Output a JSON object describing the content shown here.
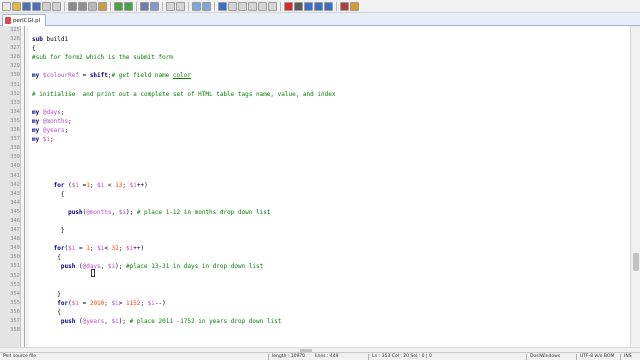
{
  "toolbar": {
    "buttons": [
      {
        "icon": "new-file-icon",
        "color": "#e9e9e9"
      },
      {
        "icon": "open-folder-icon",
        "color": "#e2b84a"
      },
      {
        "icon": "save-icon",
        "color": "#4a6fb5"
      },
      {
        "icon": "save-all-icon",
        "color": "#4a6fb5"
      },
      {
        "icon": "close-icon",
        "color": "#d0d0d0"
      },
      {
        "icon": "close-all-icon",
        "color": "#d0d0d0"
      },
      {
        "icon": "print-icon",
        "color": "#8a8a8a"
      },
      {
        "icon": "cut-icon",
        "color": "#8f8f8f"
      },
      {
        "icon": "copy-icon",
        "color": "#b9b9b9"
      },
      {
        "icon": "paste-icon",
        "color": "#c89a4a"
      },
      {
        "icon": "undo-icon",
        "color": "#4aa04a"
      },
      {
        "icon": "redo-icon",
        "color": "#4aa04a"
      },
      {
        "icon": "find-icon",
        "color": "#6b7fa8"
      },
      {
        "icon": "replace-icon",
        "color": "#7f9ad1"
      },
      {
        "icon": "zoom-in-icon",
        "color": "#d4d4d4"
      },
      {
        "icon": "zoom-out-icon",
        "color": "#d4d4d4"
      },
      {
        "icon": "sync-vertical-icon",
        "color": "#7fa7d9"
      },
      {
        "icon": "sync-horizontal-icon",
        "color": "#7fa7d9"
      },
      {
        "icon": "word-wrap-icon",
        "color": "#3b6fc4"
      },
      {
        "icon": "show-all-chars-icon",
        "color": "#d4d4d4"
      },
      {
        "icon": "indent-guide-icon",
        "color": "#d4d4d4"
      },
      {
        "icon": "define-language-icon",
        "color": "#d4d4d4"
      },
      {
        "icon": "doc-map-icon",
        "color": "#d4d4d4"
      },
      {
        "icon": "function-list-icon",
        "color": "#d4d4d4"
      },
      {
        "icon": "record-macro-icon",
        "color": "#d42a2a"
      },
      {
        "icon": "stop-recording-icon",
        "color": "#5a5a5a"
      },
      {
        "icon": "playback-macro-icon",
        "color": "#3b6fc4"
      },
      {
        "icon": "run-macro-multiple-icon",
        "color": "#3b6fc4"
      },
      {
        "icon": "save-macro-icon",
        "color": "#3b6fc4"
      },
      {
        "icon": "spell-check-icon",
        "color": "#b04040"
      },
      {
        "icon": "plugin-icon",
        "color": "#d49a2a"
      }
    ]
  },
  "tabs": [
    {
      "label": "perlCGI.pl",
      "icon": "perl-file-icon",
      "color": "#d94b4b"
    }
  ],
  "editor": {
    "lines": [
      {
        "n": "325",
        "segs": []
      },
      {
        "n": "326",
        "segs": [
          {
            "t": "sub ",
            "c": "kw"
          },
          {
            "t": "build1",
            "c": ""
          }
        ]
      },
      {
        "n": "327",
        "segs": [
          {
            "t": "{",
            "c": ""
          }
        ]
      },
      {
        "n": "328",
        "segs": [
          {
            "t": "#sub for form2 which is the submit form",
            "c": "cmt"
          }
        ]
      },
      {
        "n": "329",
        "segs": []
      },
      {
        "n": "330",
        "segs": [
          {
            "t": "my ",
            "c": "kw"
          },
          {
            "t": "$colourRef",
            "c": "var"
          },
          {
            "t": " = ",
            "c": ""
          },
          {
            "t": "shift",
            "c": "kw"
          },
          {
            "t": ";",
            "c": ""
          },
          {
            "t": "# get field name ",
            "c": "cmt"
          },
          {
            "t": "color",
            "c": "cmt und"
          }
        ]
      },
      {
        "n": "331",
        "segs": []
      },
      {
        "n": "332",
        "segs": [
          {
            "t": "# initialise  and print out a complete set of HTML table tags name, value, and index",
            "c": "cmt"
          }
        ]
      },
      {
        "n": "333",
        "segs": []
      },
      {
        "n": "334",
        "segs": [
          {
            "t": "my ",
            "c": "kw"
          },
          {
            "t": "@days",
            "c": "var"
          },
          {
            "t": ";",
            "c": ""
          }
        ]
      },
      {
        "n": "335",
        "segs": [
          {
            "t": "my ",
            "c": "kw"
          },
          {
            "t": "@months",
            "c": "var"
          },
          {
            "t": ";",
            "c": ""
          }
        ]
      },
      {
        "n": "336",
        "segs": [
          {
            "t": "my ",
            "c": "kw"
          },
          {
            "t": "@years",
            "c": "var"
          },
          {
            "t": ";",
            "c": ""
          }
        ]
      },
      {
        "n": "337",
        "segs": [
          {
            "t": "my ",
            "c": "kw"
          },
          {
            "t": "$i",
            "c": "var"
          },
          {
            "t": ";",
            "c": ""
          }
        ]
      },
      {
        "n": "338",
        "segs": []
      },
      {
        "n": "339",
        "segs": []
      },
      {
        "n": "340",
        "segs": []
      },
      {
        "n": "341",
        "segs": []
      },
      {
        "n": "342",
        "segs": [
          {
            "t": "      for ",
            "c": "kw"
          },
          {
            "t": "(",
            "c": ""
          },
          {
            "t": "$i",
            "c": "var"
          },
          {
            "t": " =",
            "c": ""
          },
          {
            "t": "1",
            "c": "num"
          },
          {
            "t": "; ",
            "c": ""
          },
          {
            "t": "$i",
            "c": "var"
          },
          {
            "t": " < ",
            "c": ""
          },
          {
            "t": "13",
            "c": "num"
          },
          {
            "t": "; ",
            "c": ""
          },
          {
            "t": "$i",
            "c": "var"
          },
          {
            "t": "++)",
            "c": ""
          }
        ]
      },
      {
        "n": "343",
        "segs": [
          {
            "t": "        {",
            "c": ""
          }
        ]
      },
      {
        "n": "344",
        "segs": []
      },
      {
        "n": "345",
        "segs": [
          {
            "t": "          push",
            "c": "kw"
          },
          {
            "t": "(",
            "c": ""
          },
          {
            "t": "@months",
            "c": "var"
          },
          {
            "t": ", ",
            "c": ""
          },
          {
            "t": "$i",
            "c": "var"
          },
          {
            "t": "); ",
            "c": ""
          },
          {
            "t": "# place 1-12 in months drop down list",
            "c": "cmt"
          }
        ]
      },
      {
        "n": "346",
        "segs": []
      },
      {
        "n": "347",
        "segs": [
          {
            "t": "        }",
            "c": ""
          }
        ]
      },
      {
        "n": "348",
        "segs": []
      },
      {
        "n": "349",
        "segs": [
          {
            "t": "      for",
            "c": "kw"
          },
          {
            "t": "(",
            "c": ""
          },
          {
            "t": "$i",
            "c": "var"
          },
          {
            "t": " = ",
            "c": ""
          },
          {
            "t": "1",
            "c": "num"
          },
          {
            "t": "; ",
            "c": ""
          },
          {
            "t": "$i",
            "c": "var"
          },
          {
            "t": "< ",
            "c": ""
          },
          {
            "t": "32",
            "c": "num"
          },
          {
            "t": "; ",
            "c": ""
          },
          {
            "t": "$i",
            "c": "var"
          },
          {
            "t": "++)",
            "c": ""
          }
        ]
      },
      {
        "n": "350",
        "segs": [
          {
            "t": "       {",
            "c": ""
          }
        ]
      },
      {
        "n": "351",
        "segs": [
          {
            "t": "        push ",
            "c": "kw"
          },
          {
            "t": "(",
            "c": ""
          },
          {
            "t": "@days",
            "c": "var"
          },
          {
            "t": ", ",
            "c": ""
          },
          {
            "t": "$i",
            "c": "var"
          },
          {
            "t": "); ",
            "c": ""
          },
          {
            "t": "#place 13-31 in days in drop down list",
            "c": "cmt"
          }
        ]
      },
      {
        "n": "352",
        "segs": []
      },
      {
        "n": "353",
        "segs": []
      },
      {
        "n": "354",
        "segs": [
          {
            "t": "       }",
            "c": ""
          }
        ]
      },
      {
        "n": "355",
        "segs": [
          {
            "t": "       for",
            "c": "kw"
          },
          {
            "t": "(",
            "c": ""
          },
          {
            "t": "$i",
            "c": "var"
          },
          {
            "t": " = ",
            "c": ""
          },
          {
            "t": "2010",
            "c": "num"
          },
          {
            "t": "; ",
            "c": ""
          },
          {
            "t": "$i",
            "c": "var"
          },
          {
            "t": "> ",
            "c": ""
          },
          {
            "t": "1152",
            "c": "num"
          },
          {
            "t": "; ",
            "c": ""
          },
          {
            "t": "$i",
            "c": "var"
          },
          {
            "t": "--)",
            "c": ""
          }
        ]
      },
      {
        "n": "356",
        "segs": [
          {
            "t": "       {",
            "c": ""
          }
        ]
      },
      {
        "n": "357",
        "segs": [
          {
            "t": "        push ",
            "c": "kw"
          },
          {
            "t": "(",
            "c": ""
          },
          {
            "t": "@years",
            "c": "var"
          },
          {
            "t": ", ",
            "c": ""
          },
          {
            "t": "$i",
            "c": "var"
          },
          {
            "t": "); ",
            "c": ""
          },
          {
            "t": "# place 2011 -1752 in years drop down list",
            "c": "cmt"
          }
        ]
      },
      {
        "n": "358",
        "segs": []
      }
    ]
  },
  "statusbar": {
    "file_type": "Perl source file",
    "length": "length : 10970",
    "lines": "lines : 449",
    "position": "Ln : 353   Col : 20   Sel : 0 | 0",
    "eol": "Dos\\Windows",
    "encoding": "UTF-8 w/o BOM",
    "mode": "INS"
  }
}
